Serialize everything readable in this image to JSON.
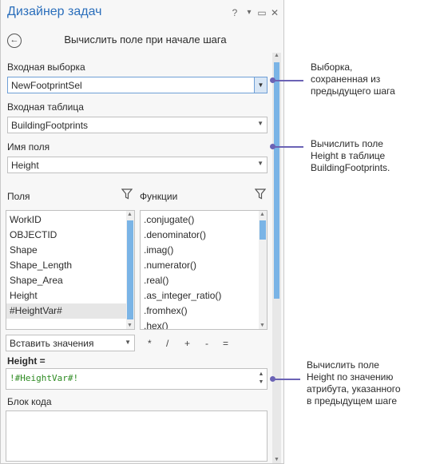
{
  "window": {
    "title": "Дизайнер задач",
    "help_glyph": "?",
    "menu_glyph": "▾",
    "pin_glyph": "▭",
    "close_glyph": "✕"
  },
  "step": {
    "back_glyph": "←",
    "title": "Вычислить поле при начале шага"
  },
  "input_selection": {
    "label": "Входная выборка",
    "value": "NewFootprintSel"
  },
  "input_table": {
    "label": "Входная таблица",
    "value": "BuildingFootprints"
  },
  "field_name": {
    "label": "Имя поля",
    "value": "Height"
  },
  "fields": {
    "label": "Поля",
    "items": [
      "WorkID",
      "OBJECTID",
      "Shape",
      "Shape_Length",
      "Shape_Area",
      "Height",
      "#HeightVar#"
    ],
    "selected_index": 6
  },
  "functions": {
    "label": "Функции",
    "items": [
      ".conjugate()",
      ".denominator()",
      ".imag()",
      ".numerator()",
      ".real()",
      ".as_integer_ratio()",
      ".fromhex()",
      ".hex()"
    ]
  },
  "insert_values": {
    "label": "Вставить значения"
  },
  "operators": [
    "*",
    "/",
    "+",
    "-",
    "="
  ],
  "expression": {
    "label": "Height =",
    "value": "!#HeightVar#!"
  },
  "code_block": {
    "label": "Блок кода"
  },
  "callouts": [
    {
      "lines": [
        "Выборка,",
        "сохраненная из",
        "предыдущего шага"
      ]
    },
    {
      "lines": [
        "Вычислить поле",
        "Height в таблице",
        "BuildingFootprints."
      ]
    },
    {
      "lines": [
        "Вычислить поле",
        "Height по значению",
        "атрибута, указанного",
        "в предыдущем шаге"
      ]
    }
  ],
  "colors": {
    "title_blue": "#2a6ebb",
    "scroll_thumb": "#7ab4e6",
    "callout_line": "#6b63b5",
    "expression_green": "#2e8b22"
  },
  "icons": {
    "back": "back-arrow-icon",
    "filter": "filter-icon"
  }
}
